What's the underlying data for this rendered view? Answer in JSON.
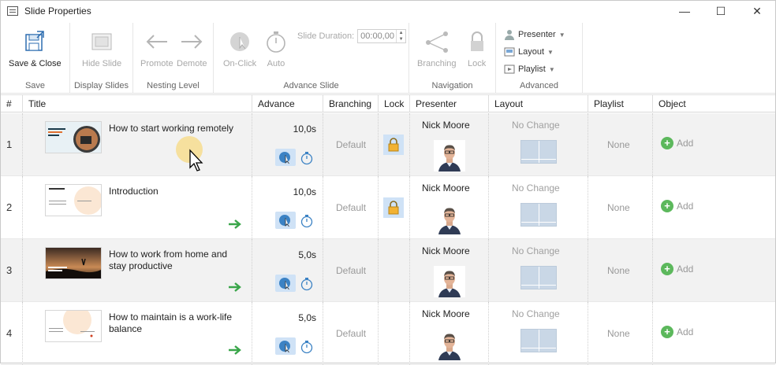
{
  "window": {
    "title": "Slide Properties",
    "minimize": "—",
    "maximize": "☐",
    "close": "✕"
  },
  "ribbon": {
    "save": {
      "button": "Save & Close",
      "group": "Save"
    },
    "display": {
      "button": "Hide Slide",
      "group": "Display Slides"
    },
    "nesting": {
      "promote": "Promote",
      "demote": "Demote",
      "group": "Nesting Level"
    },
    "advance": {
      "on_click": "On-Click",
      "auto": "Auto",
      "duration_label": "Slide Duration:",
      "duration_value": "00:00,00",
      "group": "Advance Slide"
    },
    "navigation": {
      "branching": "Branching",
      "lock": "Lock",
      "group": "Navigation"
    },
    "advanced": {
      "presenter": "Presenter",
      "layout": "Layout",
      "playlist": "Playlist",
      "group": "Advanced"
    }
  },
  "table": {
    "headers": [
      "#",
      "Title",
      "Advance",
      "Branching",
      "Lock",
      "Presenter",
      "Layout",
      "Playlist",
      "Object"
    ],
    "rows": [
      {
        "num": "1",
        "title": "How to start working remotely",
        "advance": "10,0s",
        "branching": "Default",
        "locked": true,
        "presenter": "Nick Moore",
        "layout": "No Change",
        "playlist": "None",
        "object": "Add",
        "nested": false,
        "thumb_text": "How to start working from home"
      },
      {
        "num": "2",
        "title": "Introduction",
        "advance": "10,0s",
        "branching": "Default",
        "locked": true,
        "presenter": "Nick Moore",
        "layout": "No Change",
        "playlist": "None",
        "object": "Add",
        "nested": true,
        "thumb_text": "Introduction"
      },
      {
        "num": "3",
        "title": "How to work from home and stay productive",
        "advance": "5,0s",
        "branching": "Default",
        "locked": false,
        "presenter": "Nick Moore",
        "layout": "No Change",
        "playlist": "None",
        "object": "Add",
        "nested": true,
        "thumb_text": "How to work from home and stay productive"
      },
      {
        "num": "4",
        "title": "How to maintain is a work-life balance",
        "advance": "5,0s",
        "branching": "Default",
        "locked": false,
        "presenter": "Nick Moore",
        "layout": "No Change",
        "playlist": "None",
        "object": "Add",
        "nested": true,
        "thumb_text": ""
      }
    ]
  },
  "colors": {
    "accent": "#cfe2f6",
    "lock": "#f2b233",
    "add_green": "#5cb85c",
    "arrow_green": "#3aa64a",
    "row_shade": "#f2f2f2"
  }
}
